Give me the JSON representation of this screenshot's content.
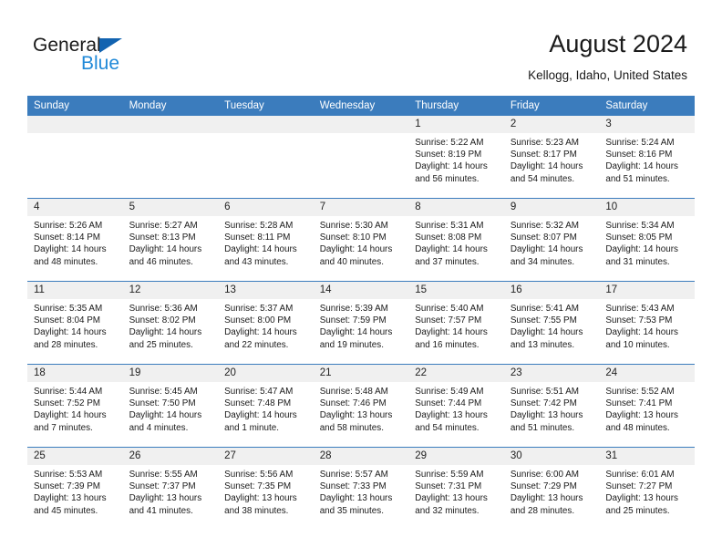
{
  "brand": {
    "name_part1": "General",
    "name_part2": "Blue",
    "triangle_color": "#1263b0",
    "blue_color": "#2089d8"
  },
  "header": {
    "title": "August 2024",
    "subtitle": "Kellogg, Idaho, United States"
  },
  "theme": {
    "header_blue": "#3b7cbd",
    "daynum_bg": "#f0f0f0"
  },
  "weekday_headers": [
    "Sunday",
    "Monday",
    "Tuesday",
    "Wednesday",
    "Thursday",
    "Friday",
    "Saturday"
  ],
  "weeks": [
    [
      {
        "day": "",
        "sunrise": "",
        "sunset": "",
        "daylight1": "",
        "daylight2": ""
      },
      {
        "day": "",
        "sunrise": "",
        "sunset": "",
        "daylight1": "",
        "daylight2": ""
      },
      {
        "day": "",
        "sunrise": "",
        "sunset": "",
        "daylight1": "",
        "daylight2": ""
      },
      {
        "day": "",
        "sunrise": "",
        "sunset": "",
        "daylight1": "",
        "daylight2": ""
      },
      {
        "day": "1",
        "sunrise": "Sunrise: 5:22 AM",
        "sunset": "Sunset: 8:19 PM",
        "daylight1": "Daylight: 14 hours",
        "daylight2": "and 56 minutes."
      },
      {
        "day": "2",
        "sunrise": "Sunrise: 5:23 AM",
        "sunset": "Sunset: 8:17 PM",
        "daylight1": "Daylight: 14 hours",
        "daylight2": "and 54 minutes."
      },
      {
        "day": "3",
        "sunrise": "Sunrise: 5:24 AM",
        "sunset": "Sunset: 8:16 PM",
        "daylight1": "Daylight: 14 hours",
        "daylight2": "and 51 minutes."
      }
    ],
    [
      {
        "day": "4",
        "sunrise": "Sunrise: 5:26 AM",
        "sunset": "Sunset: 8:14 PM",
        "daylight1": "Daylight: 14 hours",
        "daylight2": "and 48 minutes."
      },
      {
        "day": "5",
        "sunrise": "Sunrise: 5:27 AM",
        "sunset": "Sunset: 8:13 PM",
        "daylight1": "Daylight: 14 hours",
        "daylight2": "and 46 minutes."
      },
      {
        "day": "6",
        "sunrise": "Sunrise: 5:28 AM",
        "sunset": "Sunset: 8:11 PM",
        "daylight1": "Daylight: 14 hours",
        "daylight2": "and 43 minutes."
      },
      {
        "day": "7",
        "sunrise": "Sunrise: 5:30 AM",
        "sunset": "Sunset: 8:10 PM",
        "daylight1": "Daylight: 14 hours",
        "daylight2": "and 40 minutes."
      },
      {
        "day": "8",
        "sunrise": "Sunrise: 5:31 AM",
        "sunset": "Sunset: 8:08 PM",
        "daylight1": "Daylight: 14 hours",
        "daylight2": "and 37 minutes."
      },
      {
        "day": "9",
        "sunrise": "Sunrise: 5:32 AM",
        "sunset": "Sunset: 8:07 PM",
        "daylight1": "Daylight: 14 hours",
        "daylight2": "and 34 minutes."
      },
      {
        "day": "10",
        "sunrise": "Sunrise: 5:34 AM",
        "sunset": "Sunset: 8:05 PM",
        "daylight1": "Daylight: 14 hours",
        "daylight2": "and 31 minutes."
      }
    ],
    [
      {
        "day": "11",
        "sunrise": "Sunrise: 5:35 AM",
        "sunset": "Sunset: 8:04 PM",
        "daylight1": "Daylight: 14 hours",
        "daylight2": "and 28 minutes."
      },
      {
        "day": "12",
        "sunrise": "Sunrise: 5:36 AM",
        "sunset": "Sunset: 8:02 PM",
        "daylight1": "Daylight: 14 hours",
        "daylight2": "and 25 minutes."
      },
      {
        "day": "13",
        "sunrise": "Sunrise: 5:37 AM",
        "sunset": "Sunset: 8:00 PM",
        "daylight1": "Daylight: 14 hours",
        "daylight2": "and 22 minutes."
      },
      {
        "day": "14",
        "sunrise": "Sunrise: 5:39 AM",
        "sunset": "Sunset: 7:59 PM",
        "daylight1": "Daylight: 14 hours",
        "daylight2": "and 19 minutes."
      },
      {
        "day": "15",
        "sunrise": "Sunrise: 5:40 AM",
        "sunset": "Sunset: 7:57 PM",
        "daylight1": "Daylight: 14 hours",
        "daylight2": "and 16 minutes."
      },
      {
        "day": "16",
        "sunrise": "Sunrise: 5:41 AM",
        "sunset": "Sunset: 7:55 PM",
        "daylight1": "Daylight: 14 hours",
        "daylight2": "and 13 minutes."
      },
      {
        "day": "17",
        "sunrise": "Sunrise: 5:43 AM",
        "sunset": "Sunset: 7:53 PM",
        "daylight1": "Daylight: 14 hours",
        "daylight2": "and 10 minutes."
      }
    ],
    [
      {
        "day": "18",
        "sunrise": "Sunrise: 5:44 AM",
        "sunset": "Sunset: 7:52 PM",
        "daylight1": "Daylight: 14 hours",
        "daylight2": "and 7 minutes."
      },
      {
        "day": "19",
        "sunrise": "Sunrise: 5:45 AM",
        "sunset": "Sunset: 7:50 PM",
        "daylight1": "Daylight: 14 hours",
        "daylight2": "and 4 minutes."
      },
      {
        "day": "20",
        "sunrise": "Sunrise: 5:47 AM",
        "sunset": "Sunset: 7:48 PM",
        "daylight1": "Daylight: 14 hours",
        "daylight2": "and 1 minute."
      },
      {
        "day": "21",
        "sunrise": "Sunrise: 5:48 AM",
        "sunset": "Sunset: 7:46 PM",
        "daylight1": "Daylight: 13 hours",
        "daylight2": "and 58 minutes."
      },
      {
        "day": "22",
        "sunrise": "Sunrise: 5:49 AM",
        "sunset": "Sunset: 7:44 PM",
        "daylight1": "Daylight: 13 hours",
        "daylight2": "and 54 minutes."
      },
      {
        "day": "23",
        "sunrise": "Sunrise: 5:51 AM",
        "sunset": "Sunset: 7:42 PM",
        "daylight1": "Daylight: 13 hours",
        "daylight2": "and 51 minutes."
      },
      {
        "day": "24",
        "sunrise": "Sunrise: 5:52 AM",
        "sunset": "Sunset: 7:41 PM",
        "daylight1": "Daylight: 13 hours",
        "daylight2": "and 48 minutes."
      }
    ],
    [
      {
        "day": "25",
        "sunrise": "Sunrise: 5:53 AM",
        "sunset": "Sunset: 7:39 PM",
        "daylight1": "Daylight: 13 hours",
        "daylight2": "and 45 minutes."
      },
      {
        "day": "26",
        "sunrise": "Sunrise: 5:55 AM",
        "sunset": "Sunset: 7:37 PM",
        "daylight1": "Daylight: 13 hours",
        "daylight2": "and 41 minutes."
      },
      {
        "day": "27",
        "sunrise": "Sunrise: 5:56 AM",
        "sunset": "Sunset: 7:35 PM",
        "daylight1": "Daylight: 13 hours",
        "daylight2": "and 38 minutes."
      },
      {
        "day": "28",
        "sunrise": "Sunrise: 5:57 AM",
        "sunset": "Sunset: 7:33 PM",
        "daylight1": "Daylight: 13 hours",
        "daylight2": "and 35 minutes."
      },
      {
        "day": "29",
        "sunrise": "Sunrise: 5:59 AM",
        "sunset": "Sunset: 7:31 PM",
        "daylight1": "Daylight: 13 hours",
        "daylight2": "and 32 minutes."
      },
      {
        "day": "30",
        "sunrise": "Sunrise: 6:00 AM",
        "sunset": "Sunset: 7:29 PM",
        "daylight1": "Daylight: 13 hours",
        "daylight2": "and 28 minutes."
      },
      {
        "day": "31",
        "sunrise": "Sunrise: 6:01 AM",
        "sunset": "Sunset: 7:27 PM",
        "daylight1": "Daylight: 13 hours",
        "daylight2": "and 25 minutes."
      }
    ]
  ]
}
